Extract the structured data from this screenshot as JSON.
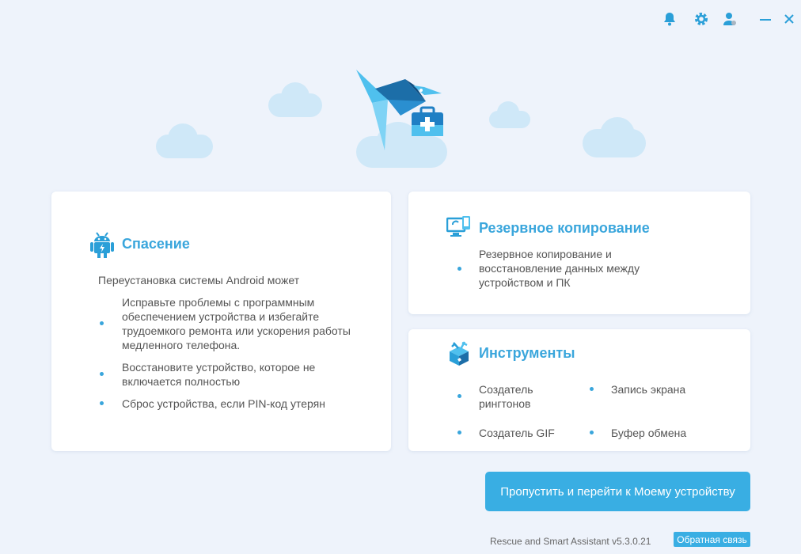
{
  "window": {
    "title": "Rescue and Smart Assistant",
    "controls": [
      "bell-icon",
      "gear-icon",
      "user-icon",
      "minimize-icon",
      "close-icon"
    ]
  },
  "rescue": {
    "title": "Спасение",
    "intro": "Переустановка системы Android может",
    "bullets": [
      "Исправьте проблемы с программным обеспечением устройства и избегайте трудоемкого ремонта или ускорения работы медленного телефона.",
      "Восстановите устройство, которое не включается полностью",
      "Сброс устройства, если PIN-код утерян"
    ]
  },
  "backup": {
    "title": "Резервное копирование",
    "bullet": "Резервное копирование и восстановление данных между устройством и ПК"
  },
  "tools": {
    "title": "Инструменты",
    "items": [
      "Создатель рингтонов",
      "Запись экрана",
      "Создатель GIF",
      "Буфер обмена"
    ]
  },
  "skip_button": "Пропустить и перейти к Моему устройству",
  "version": "Rescue and Smart Assistant v5.3.0.21",
  "feedback_button": "Обратная связь",
  "colors": {
    "accent": "#39aee3",
    "background": "#eef3fb",
    "card": "#ffffff"
  }
}
